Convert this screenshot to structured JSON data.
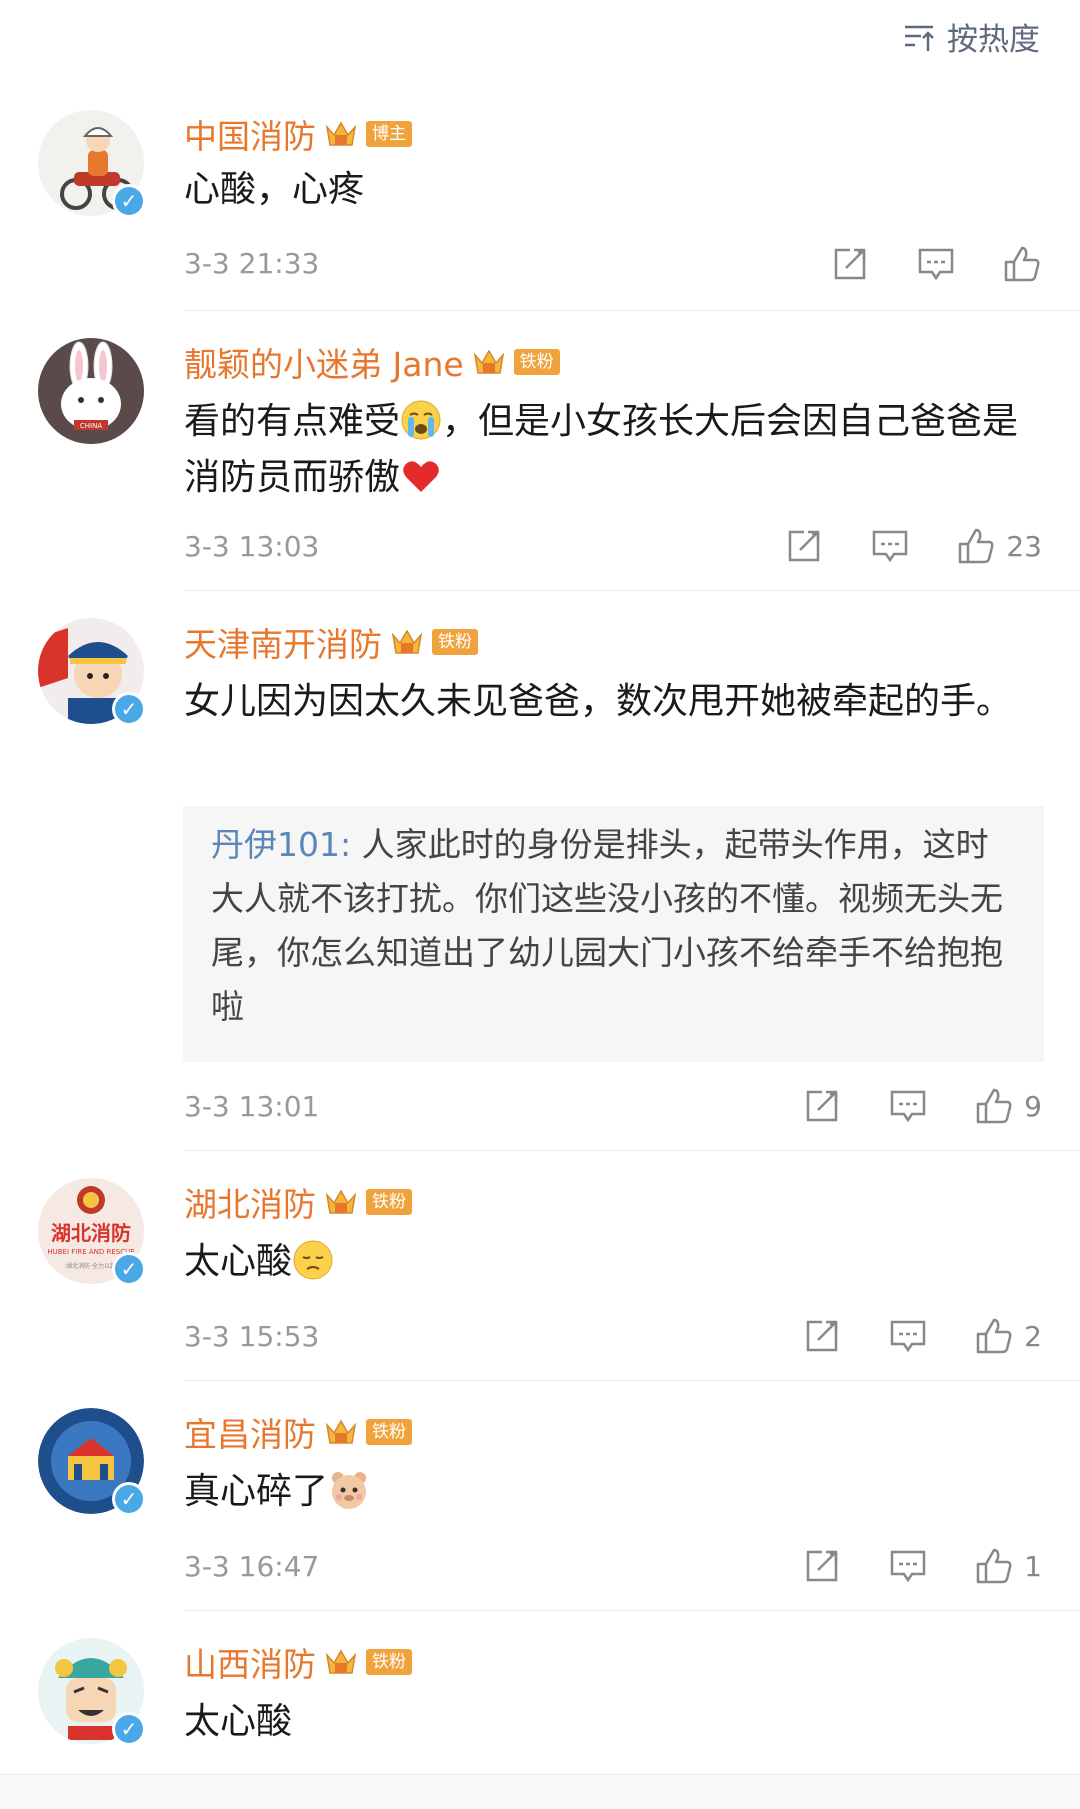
{
  "header": {
    "sort_label": "按热度"
  },
  "comments": [
    {
      "name": "中国消防",
      "tag": "博主",
      "text": "心酸，心疼",
      "time": "3-3 21:33",
      "likes": ""
    },
    {
      "name": "靓颖的小迷弟 Jane",
      "tag": "铁粉",
      "text_a": "看的有点难受",
      "text_b": "，但是小女孩长大后会因自己爸爸是消防员而骄傲",
      "time": "3-3 13:03",
      "likes": "23"
    },
    {
      "name": "天津南开消防",
      "tag": "铁粉",
      "text": "女儿因为因太久未见爸爸，数次甩开她被牵起的手。",
      "reply": {
        "user": "丹伊101:",
        "text": " 人家此时的身份是排头，起带头作用，这时大人就不该打扰。你们这些没小孩的不懂。视频无头无尾，你怎么知道出了幼儿园大门小孩不给牵手不给抱抱啦"
      },
      "time": "3-3 13:01",
      "likes": "9"
    },
    {
      "name": "湖北消防",
      "tag": "铁粉",
      "text": "太心酸",
      "time": "3-3 15:53",
      "likes": "2"
    },
    {
      "name": "宜昌消防",
      "tag": "铁粉",
      "text": "真心碎了",
      "time": "3-3 16:47",
      "likes": "1"
    },
    {
      "name": "山西消防",
      "tag": "铁粉",
      "text": "太心酸",
      "time": "",
      "likes": ""
    }
  ],
  "avatar_labels": {
    "hubei": "湖北消防",
    "hubei_en": "HUBEI FIRE AND RESCUE",
    "hubei_small": "·湖北消防·全力以赴·",
    "china": "CHINA"
  },
  "colors": {
    "name": "#e8772e",
    "reply_user": "#5b86b8",
    "badge": "#f0a33c",
    "verify": "#4aa8e8"
  }
}
